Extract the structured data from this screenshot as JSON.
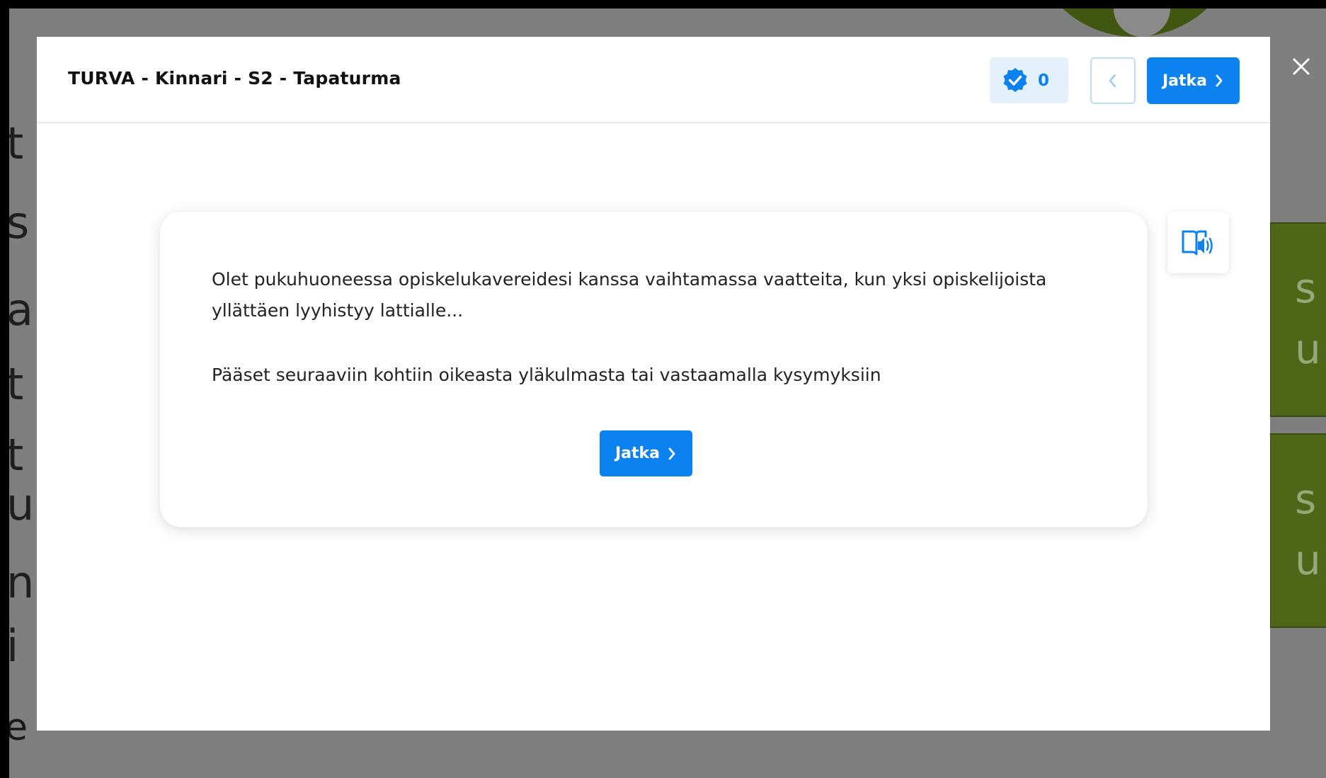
{
  "modal": {
    "title": "TURVA - Kinnari - S2 - Tapaturma",
    "score": "0",
    "next_label": "Jatka"
  },
  "content": {
    "paragraph_1": "Olet pukuhuoneessa opiskelukavereidesi kanssa vaihtamassa vaatteita, kun yksi opiskelijoista yllättäen lyyhistyy lattialle...",
    "paragraph_2": "Pääset seuraaviin kohtiin oikeasta yläkulmasta tai vastaamalla kysymyksiin",
    "continue_label": "Jatka"
  },
  "icons": {
    "score": "verified-badge-icon",
    "prev": "chevron-left-icon",
    "next": "chevron-right-icon",
    "audio": "read-aloud-icon",
    "close": "close-icon"
  },
  "colors": {
    "accent": "#0b82f0",
    "badge_bg": "#e4f0fc",
    "backdrop": "#7f7f7f",
    "background_green": "#4f6618"
  }
}
